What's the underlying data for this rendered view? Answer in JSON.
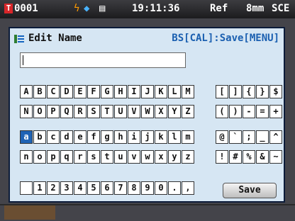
{
  "status_bar": {
    "target_badge": "T",
    "sample_id": "0001",
    "clock": "19:11:36",
    "mode": "Ref",
    "condition": "8mm",
    "geometry": "SCE"
  },
  "dialog": {
    "title": "Edit Name",
    "hint": "BS[CAL]:Save[MENU]",
    "name_value": "",
    "save_label": "Save"
  },
  "keyboard": {
    "upper": [
      "A",
      "B",
      "C",
      "D",
      "E",
      "F",
      "G",
      "H",
      "I",
      "J",
      "K",
      "L",
      "M",
      "N",
      "O",
      "P",
      "Q",
      "R",
      "S",
      "T",
      "U",
      "V",
      "W",
      "X",
      "Y",
      "Z"
    ],
    "lower": [
      "a",
      "b",
      "c",
      "d",
      "e",
      "f",
      "g",
      "h",
      "i",
      "j",
      "k",
      "l",
      "m",
      "n",
      "o",
      "p",
      "q",
      "r",
      "s",
      "t",
      "u",
      "v",
      "w",
      "x",
      "y",
      "z"
    ],
    "digits": [
      "1",
      "2",
      "3",
      "4",
      "5",
      "6",
      "7",
      "8",
      "9",
      "0",
      ".",
      ","
    ],
    "symbols": [
      "[",
      "]",
      "{",
      "}",
      "$",
      "(",
      ")",
      "-",
      "=",
      "+",
      "@",
      "`",
      ";",
      "_",
      "^",
      "!",
      "#",
      "%",
      "&",
      "~"
    ],
    "selected_key": "a"
  },
  "colors": {
    "dialog_bg": "#d6e6f3",
    "hint": "#1a5fb0",
    "selected_key": "#1f63b5",
    "target_badge": "#d9262a"
  },
  "icons": [
    "target-icon",
    "battery-icon",
    "bluetooth-icon",
    "printer-icon",
    "pencil-icon"
  ]
}
